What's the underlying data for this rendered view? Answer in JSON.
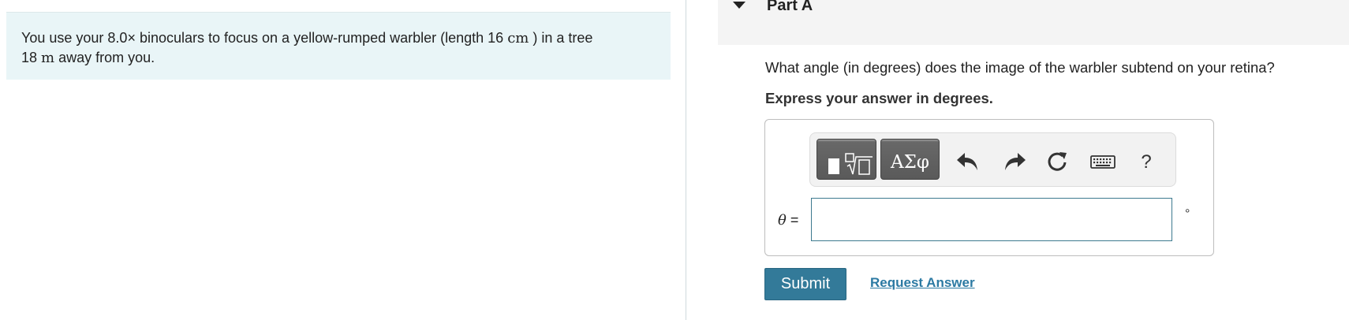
{
  "problem": {
    "text_before_mag": "You use your 8.0",
    "times_symbol": "×",
    "text_before_length": " binoculars to focus on a yellow-rumped warbler (length 16 ",
    "length_unit": "cm",
    "text_after_length": " ) in a tree",
    "distance_value": "18 ",
    "distance_unit": "m",
    "text_end": " away from you."
  },
  "part": {
    "title": "Part A",
    "question": "What angle (in degrees) does the image of the warbler subtend on your retina?",
    "instruction": "Express your answer in degrees."
  },
  "toolbar": {
    "templates_icon": "templates-radical-icon",
    "symbols_label": "ΑΣφ",
    "undo_icon": "undo-arrow-icon",
    "redo_icon": "redo-arrow-icon",
    "reset_icon": "reset-circular-arrow-icon",
    "keyboard_icon": "keyboard-icon",
    "help_label": "?"
  },
  "answer": {
    "variable": "θ",
    "equals": " =",
    "value": "",
    "placeholder": "",
    "unit": "°"
  },
  "actions": {
    "submit_label": "Submit",
    "request_label": "Request Answer"
  },
  "colors": {
    "problem_bg": "#e9f5f7",
    "submit_bg": "#337a99",
    "link": "#2c7aa3"
  }
}
